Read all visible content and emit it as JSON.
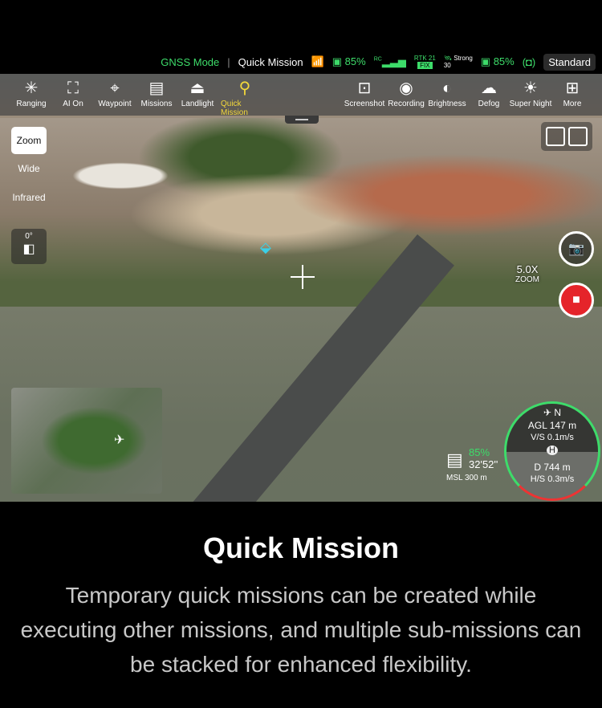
{
  "status": {
    "mode": "GNSS Mode",
    "mission": "Quick Mission",
    "rc_battery": "85%",
    "rc_label": "RC",
    "rtk": "RTK 21",
    "rtk_fix": "FIX",
    "gnss_strength": "Strong",
    "gnss_count": "30",
    "drone_battery": "85%",
    "profile": "Standard"
  },
  "toolbar": {
    "left": [
      {
        "label": "Ranging",
        "icon": "✳"
      },
      {
        "label": "AI On",
        "icon": "⛶"
      },
      {
        "label": "Waypoint",
        "icon": "⌖"
      },
      {
        "label": "Missions",
        "icon": "▤"
      },
      {
        "label": "Landlight",
        "icon": "⏏"
      },
      {
        "label": "Quick Mission",
        "icon": "⚲"
      }
    ],
    "right": [
      {
        "label": "Screenshot",
        "icon": "⊡"
      },
      {
        "label": "Recording",
        "icon": "◉"
      },
      {
        "label": "Brightness",
        "icon": "◐"
      },
      {
        "label": "Defog",
        "icon": "☁"
      },
      {
        "label": "Super Night",
        "icon": "☀"
      },
      {
        "label": "More",
        "icon": "⊞"
      }
    ]
  },
  "lens": [
    "Zoom",
    "Wide",
    "Infrared"
  ],
  "gimbal": "0°",
  "zoom": {
    "value": "5.0X",
    "label": "ZOOM"
  },
  "hud": {
    "agl": "AGL 147 m",
    "vs": "V/S 0.1m/s",
    "dist": "D 744 m",
    "hs": "H/S 0.3m/s",
    "north": "N",
    "home": "H"
  },
  "flight": {
    "battery": "85%",
    "time": "32'52''",
    "msl": "MSL 300 m"
  },
  "caption": {
    "title": "Quick Mission",
    "body": "Temporary quick missions can be created while executing other missions, and multiple sub-missions can be stacked for enhanced flexibility."
  }
}
